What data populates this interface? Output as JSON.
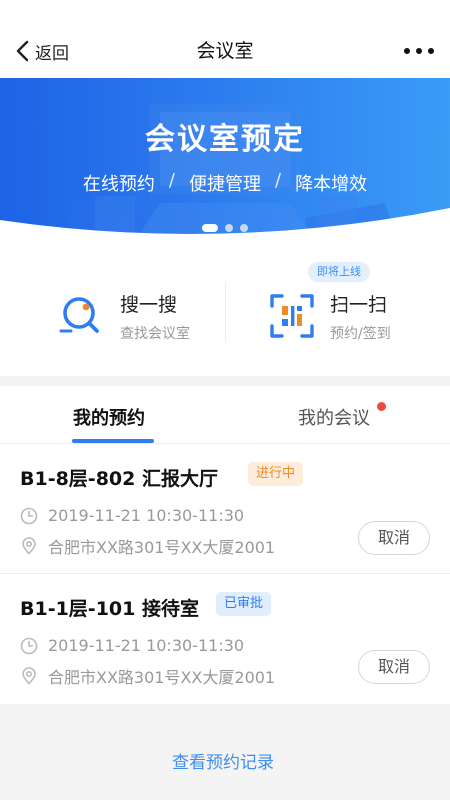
{
  "nav": {
    "back_label": "返回",
    "title": "会议室"
  },
  "banner": {
    "title": "会议室预定",
    "tags": [
      "在线预约",
      "便捷管理",
      "降本增效"
    ],
    "separator": "/"
  },
  "quick_actions": {
    "search": {
      "title": "搜一搜",
      "subtitle": "查找会议室",
      "icon": "search-magnifier-icon"
    },
    "scan": {
      "title": "扫一扫",
      "subtitle": "预约/签到",
      "icon": "qr-scan-icon",
      "badge": "即将上线"
    }
  },
  "tabs": {
    "mine": "我的预约",
    "meetings": "我的会议"
  },
  "bookings": [
    {
      "room": "B1-8层-802 汇报大厅",
      "status": "进行中",
      "time": "2019-11-21 10:30-11:30",
      "address": "合肥市XX路301号XX大厦2001",
      "action": "取消"
    },
    {
      "room": "B1-1层-101 接待室",
      "status": "已审批",
      "time": "2019-11-21 10:30-11:30",
      "address": "合肥市XX路301号XX大厦2001",
      "action": "取消"
    }
  ],
  "footer": {
    "view_records": "查看预约记录"
  },
  "colors": {
    "primary": "#2f7df0",
    "ongoing": "#f08a24",
    "notify_dot": "#f24a3a"
  }
}
